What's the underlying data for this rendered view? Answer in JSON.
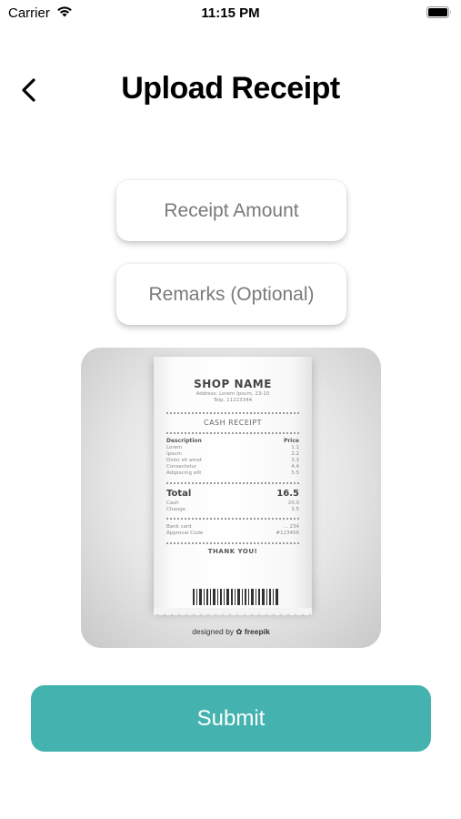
{
  "status_bar": {
    "carrier": "Carrier",
    "time": "11:15 PM"
  },
  "header": {
    "title": "Upload Receipt",
    "back_icon": "chevron-left-icon"
  },
  "form": {
    "amount_placeholder": "Receipt Amount",
    "amount_value": "",
    "remarks_placeholder": "Remarks (Optional)",
    "remarks_value": ""
  },
  "receipt_image": {
    "shop_name": "SHOP NAME",
    "address_lines": [
      "Address: Lorem Ipsum, 23-10",
      "Telp. 11223344"
    ],
    "heading": "CASH RECEIPT",
    "columns": [
      "Description",
      "Price"
    ],
    "items": [
      {
        "name": "Lorem",
        "price": "1.1"
      },
      {
        "name": "Ipsum",
        "price": "2.2"
      },
      {
        "name": "Dolor sit amet",
        "price": "3.3"
      },
      {
        "name": "Consectetur",
        "price": "4.4"
      },
      {
        "name": "Adipiscing elit",
        "price": "5.5"
      }
    ],
    "total_label": "Total",
    "total_value": "16.5",
    "cash_label": "Cash",
    "cash_value": "20.0",
    "change_label": "Change",
    "change_value": "3.5",
    "bank_card_label": "Bank card",
    "bank_card_value": "... 234",
    "approval_label": "Approval Code",
    "approval_value": "#123456",
    "thanks": "THANK YOU!",
    "credit_prefix": "designed by",
    "credit_brand": "freepik"
  },
  "actions": {
    "submit_label": "Submit"
  },
  "colors": {
    "accent": "#44b3af",
    "title": "#000000",
    "placeholder": "#7a7a7a"
  }
}
